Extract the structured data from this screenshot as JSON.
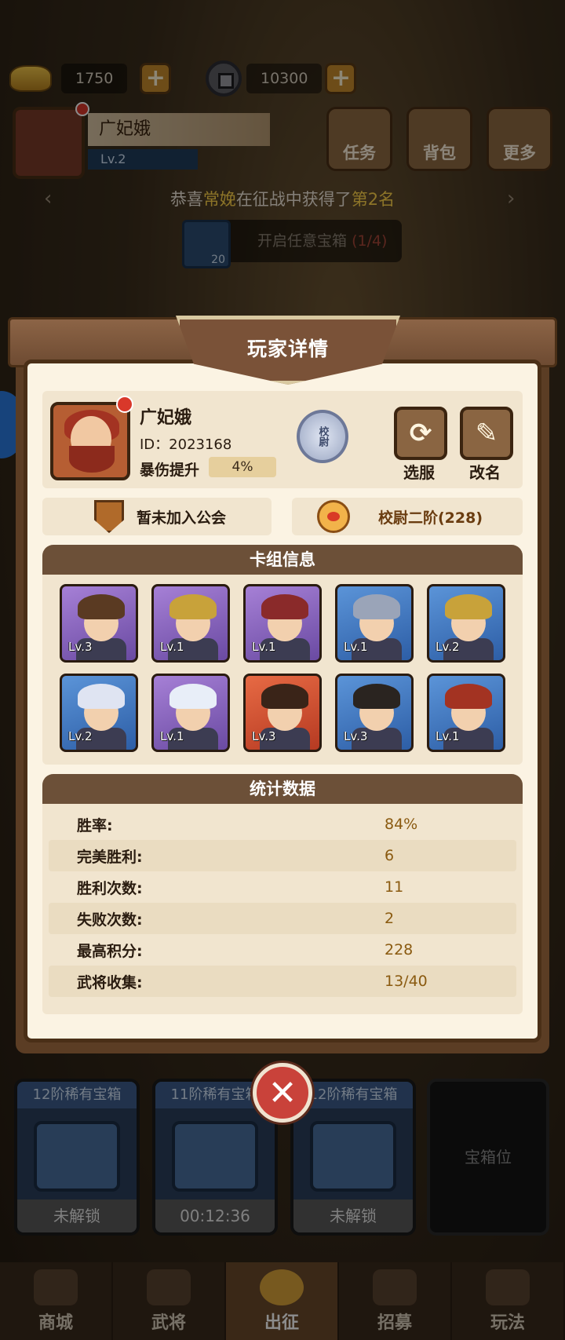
{
  "currency": {
    "gold": "1750",
    "coins": "10300"
  },
  "top_player": {
    "name": "广妃娥",
    "level": "Lv.2"
  },
  "top_buttons": {
    "tasks": "任务",
    "bag": "背包",
    "more": "更多"
  },
  "news": {
    "prefix": "恭喜",
    "player": "常娩",
    "middle": "在征战中获得了",
    "rank": "第2名"
  },
  "chest_open": {
    "label": "开启任意宝箱",
    "count": "(1/4)",
    "card_count": "20"
  },
  "dialog": {
    "title": "玩家详情",
    "profile": {
      "name": "广妃娥",
      "id": "ID：2023168",
      "crit_label": "暴伤提升",
      "crit_value": "4%",
      "rank_badge": "校尉",
      "server_button": "选服",
      "rename_button": "改名"
    },
    "guild": "暂未加入公会",
    "rank": "校尉二阶(228)",
    "deck": {
      "title": "卡组信息",
      "cards": [
        {
          "level": "Lv.3",
          "color": "purple",
          "hat": "#5a3a22"
        },
        {
          "level": "Lv.1",
          "color": "purple",
          "hat": "#c8a23a"
        },
        {
          "level": "Lv.1",
          "color": "purple",
          "hat": "#8a2a2a"
        },
        {
          "level": "Lv.1",
          "color": "blue",
          "hat": "#9aa4b8"
        },
        {
          "level": "Lv.2",
          "color": "blue",
          "hat": "#c8a23a"
        },
        {
          "level": "Lv.2",
          "color": "blue",
          "hat": "#dfe4f2"
        },
        {
          "level": "Lv.1",
          "color": "purple",
          "hat": "#e8eef8"
        },
        {
          "level": "Lv.3",
          "color": "red",
          "hat": "#3a2418"
        },
        {
          "level": "Lv.3",
          "color": "blue",
          "hat": "#2a2420"
        },
        {
          "level": "Lv.1",
          "color": "blue",
          "hat": "#a33322"
        }
      ]
    },
    "stats": {
      "title": "统计数据",
      "rows": [
        {
          "label": "胜率:",
          "value": "84%"
        },
        {
          "label": "完美胜利:",
          "value": "6"
        },
        {
          "label": "胜利次数:",
          "value": "11"
        },
        {
          "label": "失败次数:",
          "value": "2"
        },
        {
          "label": "最高积分:",
          "value": "228"
        },
        {
          "label": "武将收集:",
          "value": "13/40"
        }
      ]
    }
  },
  "chests": [
    {
      "title": "12阶稀有宝箱",
      "status": "未解锁"
    },
    {
      "title": "11阶稀有宝箱",
      "status": "00:12:36"
    },
    {
      "title": "12阶稀有宝箱",
      "status": "未解锁"
    }
  ],
  "chest_slot_empty": "宝箱位",
  "bottom_nav": [
    "商城",
    "武将",
    "出征",
    "招募",
    "玩法"
  ]
}
